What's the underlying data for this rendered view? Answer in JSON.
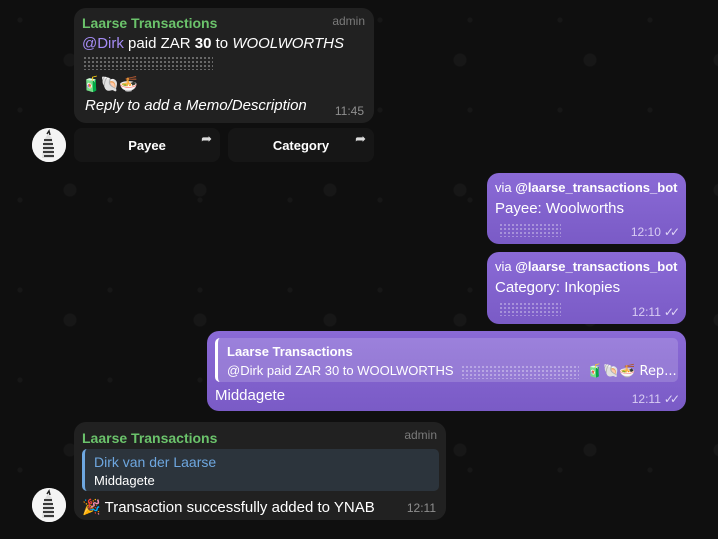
{
  "colors": {
    "background": "#0f0f0f",
    "incoming_bubble": "#212121",
    "outgoing_bubble": "#7e5fc5",
    "sender_name": "#6bc36b",
    "mention": "#a58cf5",
    "reply_author": "#6ea7e0"
  },
  "messages": [
    {
      "sender": "Laarse Transactions",
      "badge": "admin",
      "mention": "@Dirk",
      "text_paid": " paid ZAR ",
      "amount": "30",
      "text_to": " to ",
      "payee": "WOOLWORTHS",
      "emojis": "🧃🐚🍜",
      "prompt": "Reply to add a Memo/Description",
      "time": "11:45",
      "buttons": [
        {
          "label": "Payee",
          "icon": "share-arrow-icon"
        },
        {
          "label": "Category",
          "icon": "share-arrow-icon"
        }
      ]
    },
    {
      "via": "via ",
      "bot": "@laarse_transactions_bot",
      "text": "Payee: Woolworths",
      "time": "12:10"
    },
    {
      "via": "via ",
      "bot": "@laarse_transactions_bot",
      "text": "Category: Inkopies",
      "time": "12:11"
    },
    {
      "reply_author": "Laarse Transactions",
      "reply_text": "@Dirk paid ZAR 30 to WOOLWORTHS",
      "reply_tail": "🧃🐚🍜 Rep...",
      "text": "Middagete",
      "time": "12:11"
    },
    {
      "sender": "Laarse Transactions",
      "badge": "admin",
      "reply_author": "Dirk van der Laarse",
      "reply_text": "Middagete",
      "emoji": "🎉",
      "text": "Transaction successfully added to YNAB",
      "time": "12:11"
    }
  ]
}
